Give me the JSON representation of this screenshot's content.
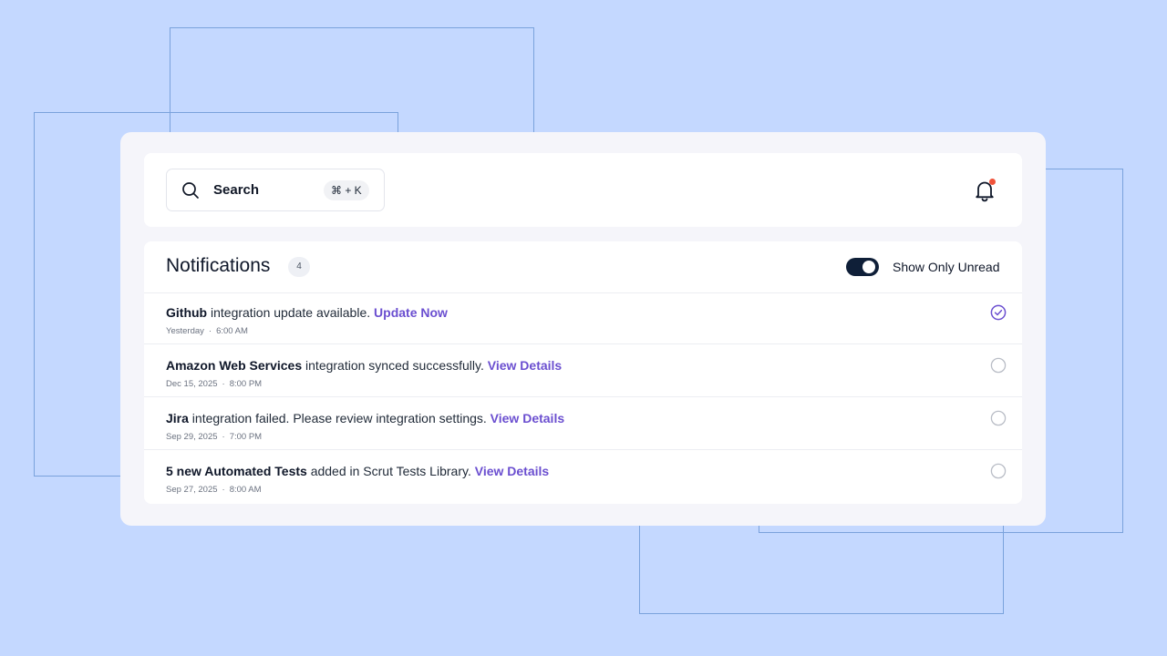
{
  "colors": {
    "background": "#c4d8ff",
    "accent": "#6b4fd0",
    "toggle_on": "#0f1f38",
    "alert_dot": "#f0533a"
  },
  "search": {
    "label": "Search",
    "shortcut": "⌘ + K",
    "icon": "search-icon"
  },
  "header": {
    "bell_icon": "bell-icon",
    "has_unread": true
  },
  "notifications": {
    "title": "Notifications",
    "count": "4",
    "toggle_label": "Show Only Unread",
    "toggle_on": true,
    "items": [
      {
        "subject": "Github",
        "text": " integration update available. ",
        "action": "Update Now",
        "date": "Yesterday",
        "time": "6:00 AM",
        "read": true
      },
      {
        "subject": "Amazon Web Services",
        "text": " integration synced successfully. ",
        "action": "View Details",
        "date": "Dec 15, 2025",
        "time": "8:00 PM",
        "read": false
      },
      {
        "subject": "Jira",
        "text": " integration failed. Please review integration settings. ",
        "action": "View Details",
        "date": "Sep 29, 2025",
        "time": "7:00 PM",
        "read": false
      },
      {
        "subject": "5 new Automated Tests",
        "text": " added in Scrut Tests Library. ",
        "action": "View Details",
        "date": "Sep 27, 2025",
        "time": "8:00 AM",
        "read": false
      }
    ]
  }
}
